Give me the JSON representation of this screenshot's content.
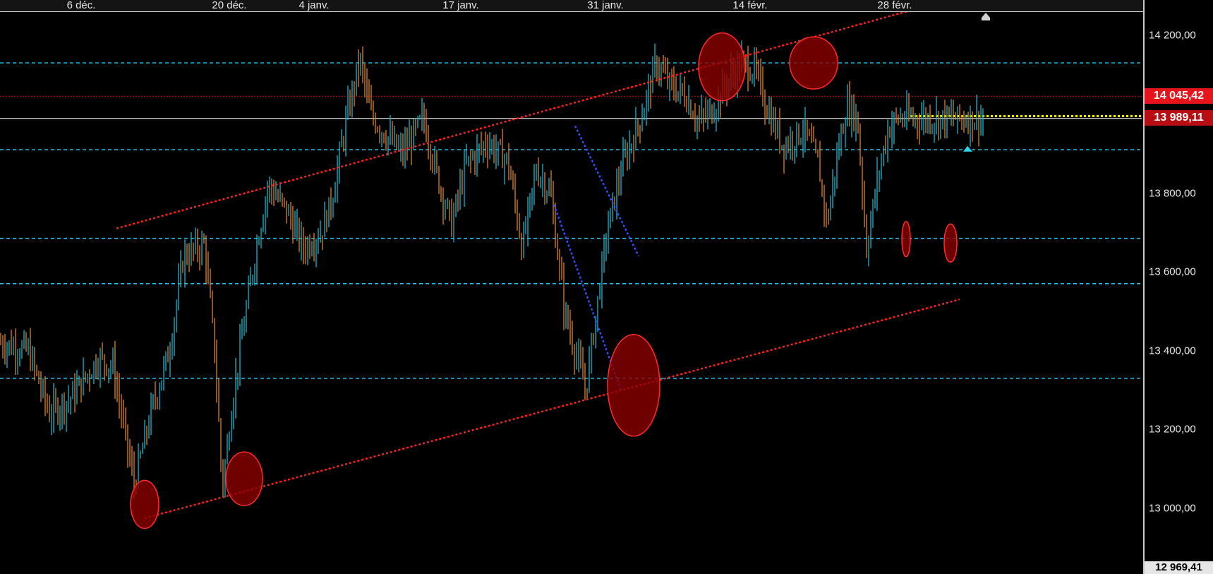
{
  "chart_data": {
    "type": "candlestick",
    "x_ticks": [
      "6 déc.",
      "20 déc.",
      "4 janv.",
      "17 janv.",
      "31 janv.",
      "14 févr.",
      "28 févr."
    ],
    "y_ticks": [
      "14 200,00",
      "13 800,00",
      "13 600,00",
      "13 400,00",
      "13 200,00",
      "13 000,00"
    ],
    "ylim": [
      12960,
      14260
    ],
    "price_tags": {
      "last_high": "14 045,42",
      "last": "13 989,11",
      "low": "12 969,41"
    },
    "horizontal_levels": [
      14130,
      13910,
      13685,
      13570,
      13330
    ],
    "trendlines": [
      {
        "style": "red-dotted",
        "from": [
          0,
          13710
        ],
        "to": [
          1,
          14290
        ]
      },
      {
        "style": "red-dotted",
        "from": [
          0,
          12975
        ],
        "to": [
          1,
          13530
        ]
      },
      {
        "style": "blue-dotted",
        "from": [
          0,
          13970
        ],
        "to": [
          1,
          13540
        ]
      }
    ],
    "colors": {
      "up": "#1fb3c7",
      "down": "#d9822b",
      "levels": "#1ec8f0",
      "trend": "#ff2020",
      "trend_blue": "#3050ff",
      "highlight": "#8b0000",
      "yellow": "#f0f000"
    },
    "waypoints": [
      [
        0,
        13420
      ],
      [
        40,
        13400
      ],
      [
        70,
        13240
      ],
      [
        100,
        13280
      ],
      [
        140,
        13380
      ],
      [
        160,
        13360
      ],
      [
        190,
        13060
      ],
      [
        215,
        13250
      ],
      [
        240,
        13400
      ],
      [
        260,
        13640
      ],
      [
        290,
        13670
      ],
      [
        305,
        13380
      ],
      [
        315,
        13050
      ],
      [
        330,
        13280
      ],
      [
        345,
        13460
      ],
      [
        365,
        13680
      ],
      [
        380,
        13820
      ],
      [
        405,
        13760
      ],
      [
        430,
        13660
      ],
      [
        455,
        13700
      ],
      [
        470,
        13780
      ],
      [
        490,
        13980
      ],
      [
        510,
        14140
      ],
      [
        525,
        14000
      ],
      [
        545,
        13950
      ],
      [
        570,
        13900
      ],
      [
        600,
        13990
      ],
      [
        620,
        13840
      ],
      [
        640,
        13720
      ],
      [
        660,
        13870
      ],
      [
        690,
        13930
      ],
      [
        720,
        13880
      ],
      [
        740,
        13660
      ],
      [
        760,
        13860
      ],
      [
        780,
        13800
      ],
      [
        800,
        13500
      ],
      [
        830,
        13300
      ],
      [
        860,
        13700
      ],
      [
        880,
        13860
      ],
      [
        910,
        14000
      ],
      [
        930,
        14130
      ],
      [
        950,
        14070
      ],
      [
        970,
        14050
      ],
      [
        990,
        13980
      ],
      [
        1010,
        14010
      ],
      [
        1030,
        14080
      ],
      [
        1050,
        14130
      ],
      [
        1070,
        14110
      ],
      [
        1090,
        14000
      ],
      [
        1110,
        13920
      ],
      [
        1140,
        13960
      ],
      [
        1160,
        13870
      ],
      [
        1172,
        13720
      ],
      [
        1185,
        13880
      ],
      [
        1200,
        14020
      ],
      [
        1215,
        13990
      ],
      [
        1228,
        13660
      ],
      [
        1245,
        13850
      ],
      [
        1258,
        13960
      ],
      [
        1272,
        13989
      ]
    ]
  }
}
